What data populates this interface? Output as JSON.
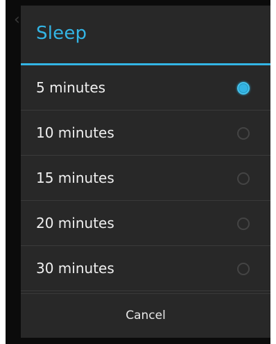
{
  "dialog": {
    "title": "Sleep",
    "accent_color": "#33b5e5",
    "options": [
      {
        "label": "5 minutes",
        "selected": true
      },
      {
        "label": "10 minutes",
        "selected": false
      },
      {
        "label": "15 minutes",
        "selected": false
      },
      {
        "label": "20 minutes",
        "selected": false
      },
      {
        "label": "30 minutes",
        "selected": false
      }
    ],
    "cancel_label": "Cancel"
  },
  "background": {
    "back_icon": "chevron-left-icon"
  }
}
